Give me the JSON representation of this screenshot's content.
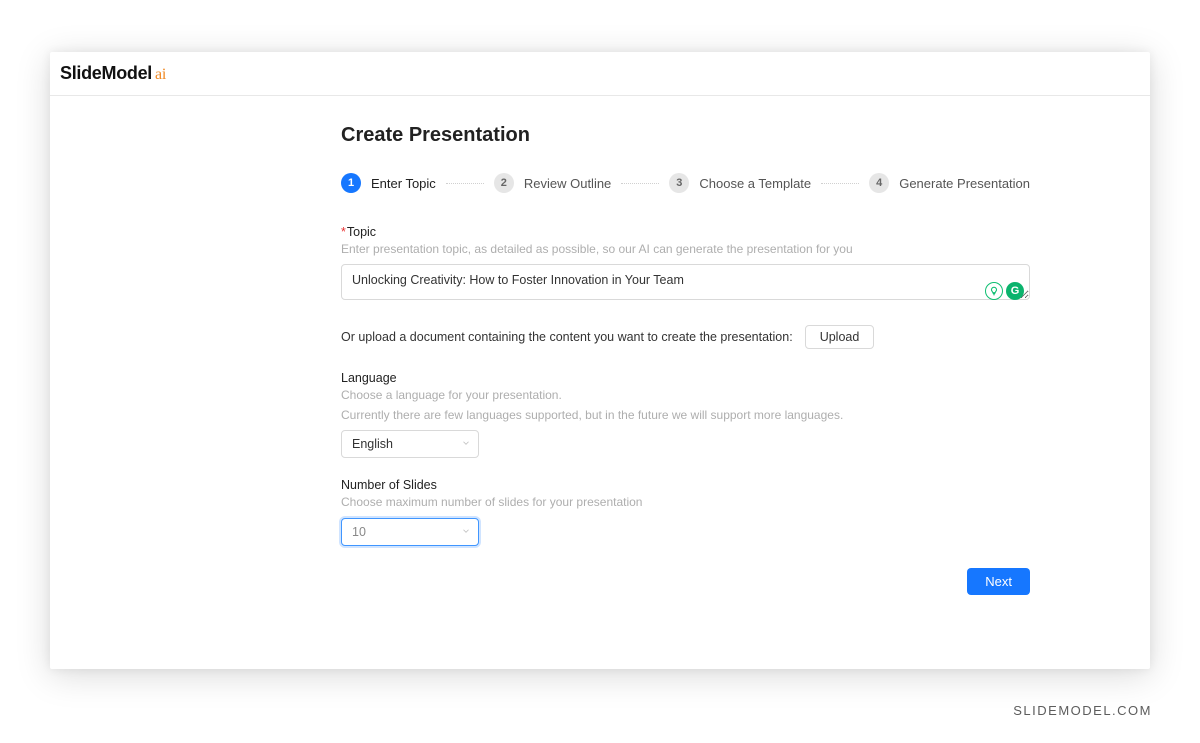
{
  "brand": {
    "main": "SlideModel",
    "accent": "ai"
  },
  "page_title": "Create Presentation",
  "steps": [
    {
      "num": "1",
      "label": "Enter Topic",
      "active": true
    },
    {
      "num": "2",
      "label": "Review Outline",
      "active": false
    },
    {
      "num": "3",
      "label": "Choose a Template",
      "active": false
    },
    {
      "num": "4",
      "label": "Generate Presentation",
      "active": false
    }
  ],
  "topic": {
    "label": "Topic",
    "help": "Enter presentation topic, as detailed as possible, so our AI can generate the presentation for you",
    "value": "Unlocking Creativity: How to Foster Innovation in Your Team"
  },
  "upload": {
    "text": "Or upload a document containing the content you want to create the presentation:",
    "button": "Upload"
  },
  "language": {
    "label": "Language",
    "help1": "Choose a language for your presentation.",
    "help2": "Currently there are few languages supported, but in the future we will support more languages.",
    "value": "English"
  },
  "slides": {
    "label": "Number of Slides",
    "help": "Choose maximum number of slides for your presentation",
    "value": "10"
  },
  "next_button": "Next",
  "watermark": "SLIDEMODEL.COM",
  "icons": {
    "idea": "idea-icon",
    "grammarly": "grammarly-icon"
  },
  "colors": {
    "primary": "#1677ff",
    "accent": "#f08a24",
    "badge_green": "#0bb36d"
  }
}
